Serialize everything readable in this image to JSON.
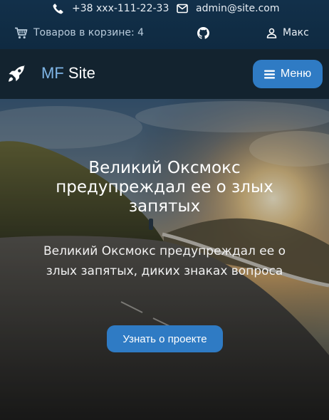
{
  "topbar": {
    "phone": "+38 xxx-111-22-33",
    "email": "admin@site.com",
    "cart": "Товаров в корзине: 4",
    "user": "Макс",
    "icons": [
      "phone-icon",
      "mail-icon",
      "cart-icon",
      "github-icon",
      "user-icon"
    ]
  },
  "navbar": {
    "brand_prefix": "MF",
    "brand_name": "Site",
    "menu_label": "Меню",
    "colors": {
      "brand_prefix": "#7fb5e6",
      "button": "#2f7bc4"
    }
  },
  "hero": {
    "title": "Великий Оксмокс предупреждал ее о злых запятых",
    "text": "Великий Оксмокс предупреждал ее о злых запятых, диких знаках вопроса",
    "cta_label": "Узнать о проекте"
  }
}
